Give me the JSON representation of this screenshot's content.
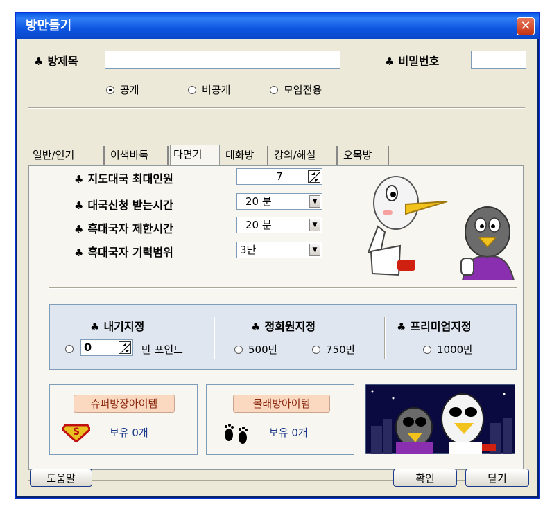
{
  "window": {
    "title": "방만들기",
    "close": "✕"
  },
  "top": {
    "room_title_label": "방제목",
    "room_title_value": "",
    "password_label": "비밀번호",
    "password_value": "",
    "visibility_options": [
      {
        "label": "공개",
        "checked": true
      },
      {
        "label": "비공개",
        "checked": false
      },
      {
        "label": "모임전용",
        "checked": false
      }
    ]
  },
  "tabs": [
    {
      "label": "일반/연기",
      "active": false
    },
    {
      "label": "이색바둑",
      "active": false
    },
    {
      "label": "다면기",
      "active": true
    },
    {
      "label": "대화방",
      "active": false
    },
    {
      "label": "강의/해설",
      "active": false
    },
    {
      "label": "오목방",
      "active": false
    }
  ],
  "settings": {
    "max_players_label": "지도대국 최대인원",
    "max_players_value": "7",
    "apply_time_label": "대국신청 받는시간",
    "apply_time_value": "20 분",
    "black_time_label": "흑대국자 제한시간",
    "black_time_value": "20 분",
    "black_range_label": "흑대국자 기력범위",
    "black_range_value": "3단"
  },
  "points": {
    "custom_label": "내기지정",
    "custom_value": "0",
    "custom_unit": "만 포인트",
    "regular_label": "정회원지정",
    "regular_options": [
      "500만",
      "750만"
    ],
    "premium_label": "프리미엄지정",
    "premium_options": [
      "1000만"
    ]
  },
  "items": {
    "super_button": "슈퍼방장아이템",
    "super_own": "보유 0개",
    "secret_button": "몰래방아이템",
    "secret_own": "보유 0개"
  },
  "buttons": {
    "help": "도움말",
    "ok": "확인",
    "close": "닫기"
  },
  "colors": {
    "title_bar": "#0a5ae6",
    "panel": "#f7f6f0",
    "point_box": "#dfe6f0",
    "item_button": "#fbd8c0"
  }
}
